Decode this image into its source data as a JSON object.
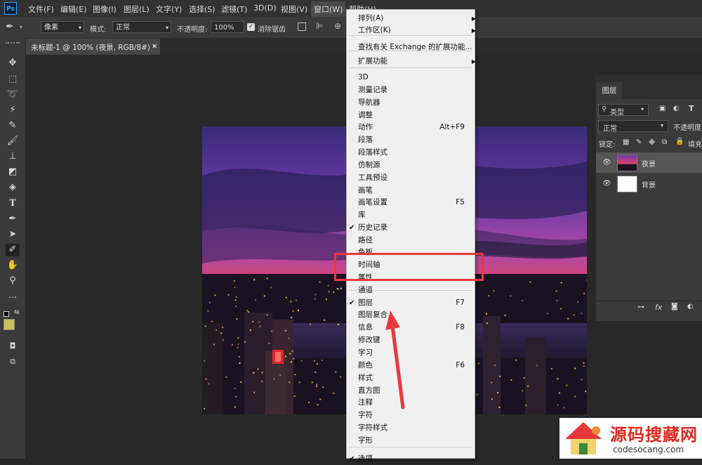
{
  "menubar": {
    "logo": "Ps",
    "items": [
      {
        "label": "文件(F)"
      },
      {
        "label": "编辑(E)"
      },
      {
        "label": "图像(I)"
      },
      {
        "label": "图层(L)"
      },
      {
        "label": "文字(Y)"
      },
      {
        "label": "选择(S)"
      },
      {
        "label": "滤镜(T)"
      },
      {
        "label": "3D(D)"
      },
      {
        "label": "视图(V)"
      },
      {
        "label": "窗口(W)"
      },
      {
        "label": "帮助(H)"
      }
    ]
  },
  "options": {
    "sample_value": "像素",
    "mode_label": "模式:",
    "mode_value": "正常",
    "opacity_label": "不透明度:",
    "opacity_value": "100%",
    "antialias_label": "消除锯齿"
  },
  "document_tab": {
    "title": "未标题-1 @ 100% (夜景, RGB/8#) *",
    "close": "×"
  },
  "layers_panel": {
    "tab": "图层",
    "filter_kind": "类型",
    "blend_mode": "正常",
    "opacity_label": "不透明度",
    "lock_label": "锁定:",
    "fill_label": "填充",
    "layers": [
      {
        "name": "夜景"
      },
      {
        "name": "背景"
      }
    ]
  },
  "window_menu": {
    "items": [
      {
        "label": "排列(A)",
        "shortcut": "",
        "submenu": "▶",
        "checked": ""
      },
      {
        "label": "工作区(K)",
        "shortcut": "",
        "submenu": "▶",
        "checked": ""
      },
      {
        "label": "查找有关 Exchange 的扩展功能...",
        "shortcut": "",
        "submenu": "",
        "checked": ""
      },
      {
        "label": "扩展功能",
        "shortcut": "",
        "submenu": "▶",
        "checked": ""
      },
      {
        "label": "3D",
        "shortcut": "",
        "submenu": "",
        "checked": ""
      },
      {
        "label": "测量记录",
        "shortcut": "",
        "submenu": "",
        "checked": ""
      },
      {
        "label": "导航器",
        "shortcut": "",
        "submenu": "",
        "checked": ""
      },
      {
        "label": "调整",
        "shortcut": "",
        "submenu": "",
        "checked": ""
      },
      {
        "label": "动作",
        "shortcut": "Alt+F9",
        "submenu": "",
        "checked": ""
      },
      {
        "label": "段落",
        "shortcut": "",
        "submenu": "",
        "checked": ""
      },
      {
        "label": "段落样式",
        "shortcut": "",
        "submenu": "",
        "checked": ""
      },
      {
        "label": "仿制源",
        "shortcut": "",
        "submenu": "",
        "checked": ""
      },
      {
        "label": "工具预设",
        "shortcut": "",
        "submenu": "",
        "checked": ""
      },
      {
        "label": "画笔",
        "shortcut": "",
        "submenu": "",
        "checked": ""
      },
      {
        "label": "画笔设置",
        "shortcut": "F5",
        "submenu": "",
        "checked": ""
      },
      {
        "label": "库",
        "shortcut": "",
        "submenu": "",
        "checked": ""
      },
      {
        "label": "历史记录",
        "shortcut": "",
        "submenu": "",
        "checked": "✔"
      },
      {
        "label": "路径",
        "shortcut": "",
        "submenu": "",
        "checked": ""
      },
      {
        "label": "色板",
        "shortcut": "",
        "submenu": "",
        "checked": ""
      },
      {
        "label": "时间轴",
        "shortcut": "",
        "submenu": "",
        "checked": ""
      },
      {
        "label": "属性",
        "shortcut": "",
        "submenu": "",
        "checked": ""
      },
      {
        "label": "通道",
        "shortcut": "",
        "submenu": "",
        "checked": ""
      },
      {
        "label": "图层",
        "shortcut": "F7",
        "submenu": "",
        "checked": "✔"
      },
      {
        "label": "图层复合",
        "shortcut": "",
        "submenu": "",
        "checked": ""
      },
      {
        "label": "信息",
        "shortcut": "F8",
        "submenu": "",
        "checked": ""
      },
      {
        "label": "修改键",
        "shortcut": "",
        "submenu": "",
        "checked": ""
      },
      {
        "label": "学习",
        "shortcut": "",
        "submenu": "",
        "checked": ""
      },
      {
        "label": "颜色",
        "shortcut": "F6",
        "submenu": "",
        "checked": ""
      },
      {
        "label": "样式",
        "shortcut": "",
        "submenu": "",
        "checked": ""
      },
      {
        "label": "直方图",
        "shortcut": "",
        "submenu": "",
        "checked": ""
      },
      {
        "label": "注释",
        "shortcut": "",
        "submenu": "",
        "checked": ""
      },
      {
        "label": "字符",
        "shortcut": "",
        "submenu": "",
        "checked": ""
      },
      {
        "label": "字符样式",
        "shortcut": "",
        "submenu": "",
        "checked": ""
      },
      {
        "label": "字形",
        "shortcut": "",
        "submenu": "",
        "checked": ""
      },
      {
        "label": "选项",
        "shortcut": "",
        "submenu": "",
        "checked": "✔"
      }
    ]
  },
  "watermark": {
    "title": "源码搜藏网",
    "url": "codesocang.com"
  },
  "colors": {
    "highlight": "#e8383c",
    "foreground_swatch": "#c9bf5a",
    "background_swatch": "#ffffff"
  }
}
